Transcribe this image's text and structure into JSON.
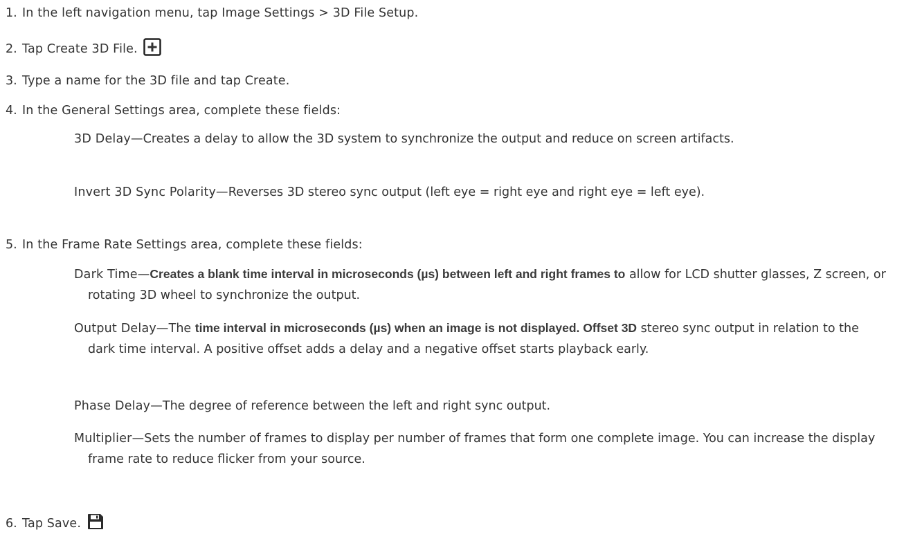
{
  "steps": [
    {
      "num": "1.",
      "text": "In the left navigation menu, tap Image Settings > 3D File Setup."
    },
    {
      "num": "2.",
      "text": "Tap Create 3D File."
    },
    {
      "num": "3.",
      "text": "Type a name for the 3D file and tap Create."
    },
    {
      "num": "4.",
      "text": "In the General Settings area, complete these fields:"
    },
    {
      "num": "5.",
      "text": "In the Frame Rate Settings area, complete these fields:"
    },
    {
      "num": "6.",
      "text": "Tap Save."
    }
  ],
  "general_fields": [
    {
      "term": "3D Delay—",
      "desc": "Creates a delay to allow the 3D system to synchronize the output and reduce on screen artifacts."
    },
    {
      "term": "Invert 3D Sync Polarity—",
      "desc": "Reverses 3D stereo sync output (left eye = right eye and right eye = left eye)."
    }
  ],
  "frame_fields": [
    {
      "term": "Dark Time—",
      "desc_bold": "Creates a blank time interval in microseconds (µs) between left and right frames to",
      "desc": "allow for LCD shutter glasses, Z screen, or rotating 3D wheel to synchronize the output."
    },
    {
      "term": "Output Delay—",
      "desc_lead": "The ",
      "desc_bold": "time interval in microseconds (µs) when an image is not displayed. Offset 3D",
      "desc": "stereo sync output in relation to the dark time interval. A positive offset adds a delay and a negative offset starts playback early."
    },
    {
      "term": "Phase Delay—",
      "desc": "The degree of reference between the left and right sync output."
    },
    {
      "term": "Multiplier—",
      "desc": "Sets the number of frames to display per number of frames that form one complete image. You can increase the display frame rate to reduce flicker from your source."
    }
  ],
  "icons": {
    "create": "plus-icon",
    "save": "save-icon"
  },
  "colors": {
    "text": "#333333",
    "icon_border": "#222222"
  }
}
